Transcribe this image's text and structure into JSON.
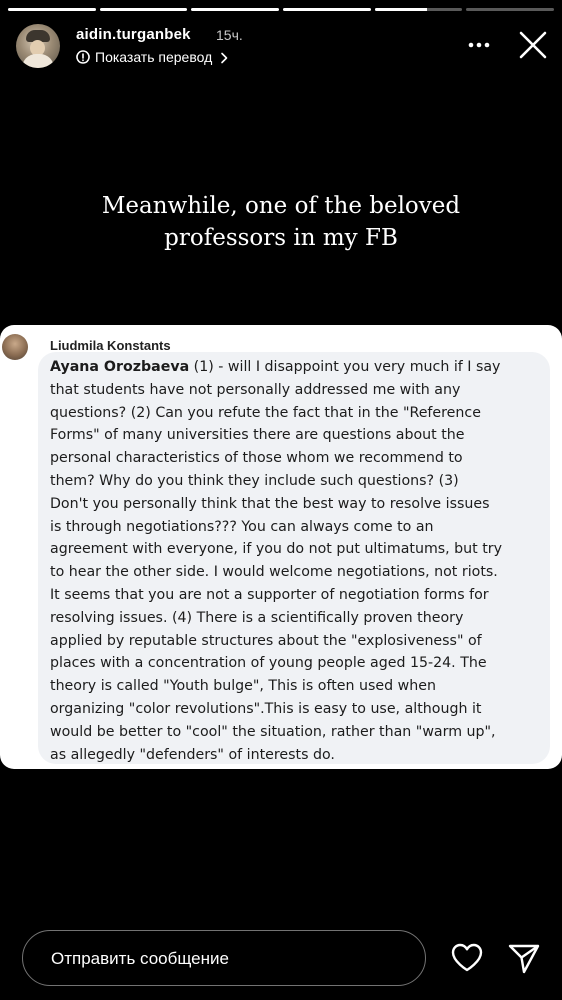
{
  "story": {
    "segment_progress": [
      1,
      1,
      1,
      1,
      0.6,
      0
    ]
  },
  "header": {
    "username": "aidin.turganbek",
    "time_ago": "15ч.",
    "translate_label": "Показать перевод",
    "more_icon": "more-horizontal-icon",
    "close_icon": "close-icon"
  },
  "caption": {
    "lines": [
      "Meanwhile, one of the beloved",
      "professors in my FB"
    ]
  },
  "comment": {
    "author": "Liudmila Konstants",
    "mention": "Ayana Orozbaeva",
    "first_line_rest": " (1) - will I disappoint you very much if I say",
    "lines": [
      "that students have not personally addressed me with any",
      "questions? (2) Can you refute the fact that in the \"Reference",
      "Forms\" of many universities there are questions about the",
      "personal characteristics of those whom we recommend to",
      "them? Why do you think they include such questions? (3)",
      "Don't you personally think that the best way to resolve issues",
      "is through negotiations??? You can always come to an",
      "agreement with everyone, if you do not put ultimatums, but try",
      "to hear the other side. I would welcome negotiations, not riots.",
      "It seems that you are not a supporter of negotiation forms for",
      "resolving issues. (4) There is a scientifically proven theory",
      "applied by reputable structures about the \"explosiveness\" of",
      "places with a concentration of young people aged 15-24. The",
      "theory is called \"Youth bulge\", This is often used when",
      "organizing \"color revolutions\".This is easy to use, although it",
      "would be better to \"cool\" the situation, rather than \"warm up\",",
      "as allegedly \"defenders\" of interests do."
    ]
  },
  "footer": {
    "message_placeholder": "Отправить сообщение",
    "like_icon": "heart-icon",
    "send_icon": "send-icon"
  }
}
